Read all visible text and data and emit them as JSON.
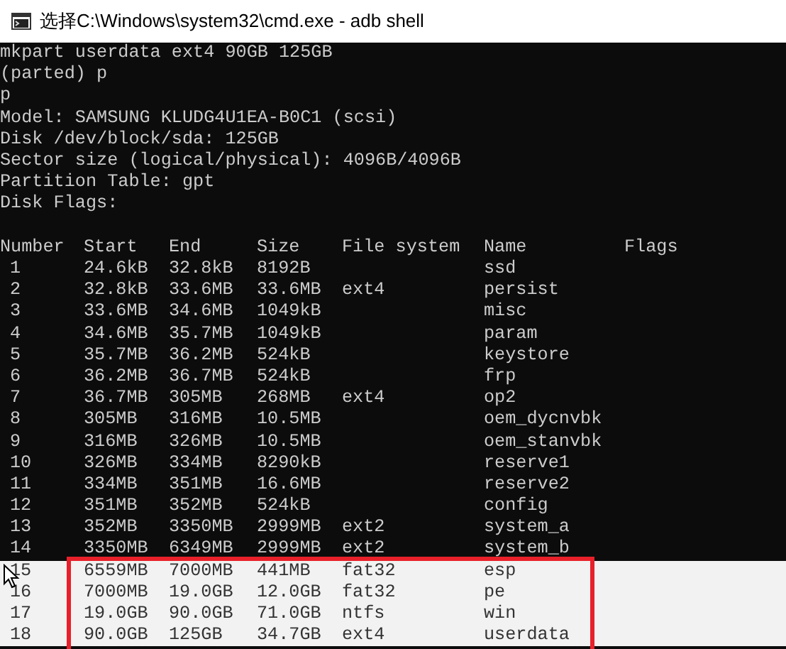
{
  "window": {
    "title": "选择C:\\Windows\\system32\\cmd.exe - adb  shell"
  },
  "lines": [
    "mkpart userdata ext4 90GB 125GB",
    "(parted) p",
    "p",
    "Model: SAMSUNG KLUDG4U1EA-B0C1 (scsi)",
    "Disk /dev/block/sda: 125GB",
    "Sector size (logical/physical): 4096B/4096B",
    "Partition Table: gpt",
    "Disk Flags:"
  ],
  "table": {
    "columns": [
      "Number",
      "Start",
      "End",
      "Size",
      "File system",
      "Name",
      "Flags"
    ],
    "rows": [
      {
        "number": "1",
        "start": "24.6kB",
        "end": "32.8kB",
        "size": "8192B",
        "file_system": "",
        "name": "ssd",
        "selected": false
      },
      {
        "number": "2",
        "start": "32.8kB",
        "end": "33.6MB",
        "size": "33.6MB",
        "file_system": "ext4",
        "name": "persist",
        "selected": false
      },
      {
        "number": "3",
        "start": "33.6MB",
        "end": "34.6MB",
        "size": "1049kB",
        "file_system": "",
        "name": "misc",
        "selected": false
      },
      {
        "number": "4",
        "start": "34.6MB",
        "end": "35.7MB",
        "size": "1049kB",
        "file_system": "",
        "name": "param",
        "selected": false
      },
      {
        "number": "5",
        "start": "35.7MB",
        "end": "36.2MB",
        "size": "524kB",
        "file_system": "",
        "name": "keystore",
        "selected": false
      },
      {
        "number": "6",
        "start": "36.2MB",
        "end": "36.7MB",
        "size": "524kB",
        "file_system": "",
        "name": "frp",
        "selected": false
      },
      {
        "number": "7",
        "start": "36.7MB",
        "end": "305MB",
        "size": "268MB",
        "file_system": "ext4",
        "name": "op2",
        "selected": false
      },
      {
        "number": "8",
        "start": "305MB",
        "end": "316MB",
        "size": "10.5MB",
        "file_system": "",
        "name": "oem_dycnvbk",
        "selected": false
      },
      {
        "number": "9",
        "start": "316MB",
        "end": "326MB",
        "size": "10.5MB",
        "file_system": "",
        "name": "oem_stanvbk",
        "selected": false
      },
      {
        "number": "10",
        "start": "326MB",
        "end": "334MB",
        "size": "8290kB",
        "file_system": "",
        "name": "reserve1",
        "selected": false
      },
      {
        "number": "11",
        "start": "334MB",
        "end": "351MB",
        "size": "16.6MB",
        "file_system": "",
        "name": "reserve2",
        "selected": false
      },
      {
        "number": "12",
        "start": "351MB",
        "end": "352MB",
        "size": "524kB",
        "file_system": "",
        "name": "config",
        "selected": false
      },
      {
        "number": "13",
        "start": "352MB",
        "end": "3350MB",
        "size": "2999MB",
        "file_system": "ext2",
        "name": "system_a",
        "selected": false
      },
      {
        "number": "14",
        "start": "3350MB",
        "end": "6349MB",
        "size": "2999MB",
        "file_system": "ext2",
        "name": "system_b",
        "selected": false
      },
      {
        "number": "15",
        "start": "6559MB",
        "end": "7000MB",
        "size": "441MB",
        "file_system": "fat32",
        "name": "esp",
        "selected": true
      },
      {
        "number": "16",
        "start": "7000MB",
        "end": "19.0GB",
        "size": "12.0GB",
        "file_system": "fat32",
        "name": "pe",
        "selected": true
      },
      {
        "number": "17",
        "start": "19.0GB",
        "end": "90.0GB",
        "size": "71.0GB",
        "file_system": "ntfs",
        "name": "win",
        "selected": true
      },
      {
        "number": "18",
        "start": "90.0GB",
        "end": "125GB",
        "size": "34.7GB",
        "file_system": "ext4",
        "name": "userdata",
        "selected": true
      }
    ]
  }
}
